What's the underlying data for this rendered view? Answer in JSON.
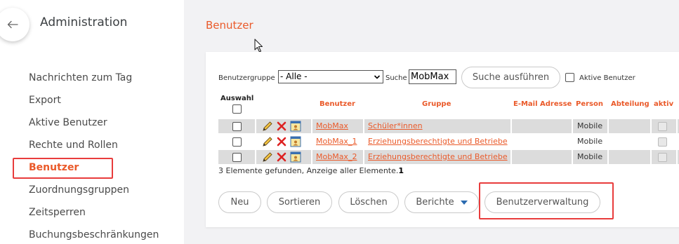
{
  "sidebar": {
    "title": "Administration",
    "items": [
      {
        "label": "Nachrichten zum Tag"
      },
      {
        "label": "Export"
      },
      {
        "label": "Aktive Benutzer"
      },
      {
        "label": "Rechte und Rollen"
      },
      {
        "label": "Benutzer"
      },
      {
        "label": "Zuordnungsgruppen"
      },
      {
        "label": "Zeitsperren"
      },
      {
        "label": "Buchungsbeschränkungen"
      }
    ],
    "active_item": "Benutzer"
  },
  "page": {
    "title": "Benutzer"
  },
  "filter": {
    "group_label": "Benutzergruppe",
    "group_value": "- Alle -",
    "search_label": "Suche",
    "search_value": "MobMax",
    "search_button": "Suche ausführen",
    "active_users_label": "Aktive Benutzer"
  },
  "table": {
    "columns": {
      "selection": "Auswahl",
      "user": "Benutzer",
      "group": "Gruppe",
      "email": "E-Mail Adresse",
      "person": "Person",
      "department": "Abteilung",
      "active": "aktiv"
    },
    "rows": [
      {
        "user": "MobMax",
        "group": "Schüler*innen",
        "email": "",
        "person": "Mobile",
        "department": ""
      },
      {
        "user": "MobMax_1",
        "group": "Erziehungsberechtigte und Betriebe",
        "email": "",
        "person": "Mobile",
        "department": ""
      },
      {
        "user": "MobMax_2",
        "group": "Erziehungsberechtigte und Betriebe",
        "email": "",
        "person": "Mobile",
        "department": ""
      }
    ],
    "summary_text": "3 Elemente gefunden, Anzeige aller Elemente.",
    "summary_page": "1"
  },
  "actions": {
    "new": "Neu",
    "sort": "Sortieren",
    "delete": "Löschen",
    "reports": "Berichte",
    "user_admin": "Benutzerverwaltung"
  },
  "colors": {
    "accent": "#ea5a2a",
    "highlight_frame": "#e83c3c"
  },
  "icons": [
    "back-arrow-icon",
    "edit-pencil-icon",
    "delete-x-icon",
    "user-detail-icon",
    "caret-down-icon",
    "mouse-cursor-icon"
  ]
}
